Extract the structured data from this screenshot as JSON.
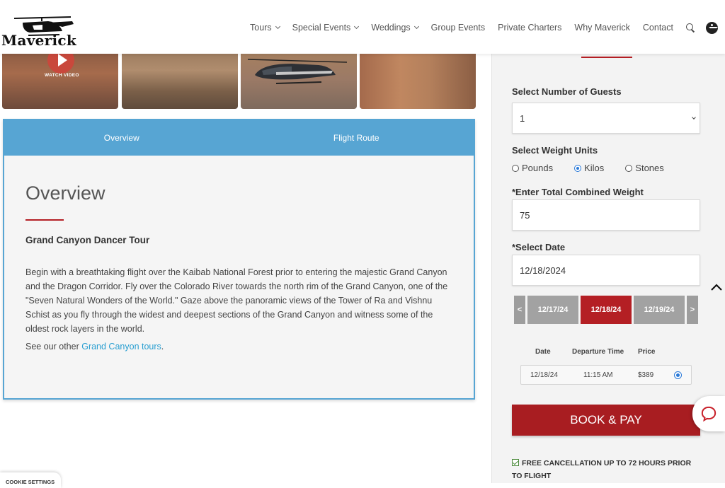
{
  "brand": {
    "name": "Maverick"
  },
  "nav": {
    "items": [
      {
        "label": "Tours",
        "dropdown": true
      },
      {
        "label": "Special Events",
        "dropdown": true
      },
      {
        "label": "Weddings",
        "dropdown": true
      },
      {
        "label": "Group Events",
        "dropdown": false
      },
      {
        "label": "Private Charters",
        "dropdown": false
      },
      {
        "label": "Why Maverick",
        "dropdown": false
      },
      {
        "label": "Contact",
        "dropdown": false
      }
    ],
    "icons": [
      "search-icon",
      "accessibility-icon"
    ]
  },
  "gallery": {
    "watch_label": "WATCH VIDEO"
  },
  "tabs": [
    {
      "label": "Overview"
    },
    {
      "label": "Flight Route"
    }
  ],
  "overview": {
    "title": "Overview",
    "tour_name": "Grand Canyon Dancer Tour",
    "description": "Begin with a breathtaking flight over the Kaibab National Forest prior to entering the majestic Grand Canyon and the Dragon Corridor. Fly over the Colorado River towards the north rim of the Grand Canyon, one of the \"Seven Natural Wonders of the World.\" Gaze above the panoramic views of the Tower of Ra and Vishnu Schist as you fly through the widest and deepest sections of the Grand Canyon and witness some of the oldest rock layers in the world.",
    "see_prefix": "See our other ",
    "see_link": "Grand Canyon tours",
    "see_suffix": "."
  },
  "booking": {
    "guests_label": "Select Number of Guests",
    "guests_value": "1",
    "weight_units_label": "Select Weight Units",
    "units": [
      {
        "label": "Pounds",
        "selected": false
      },
      {
        "label": "Kilos",
        "selected": true
      },
      {
        "label": "Stones",
        "selected": false
      }
    ],
    "weight_label": "*Enter Total Combined Weight",
    "weight_value": "75",
    "date_label": "*Select Date",
    "date_value": "12/18/2024",
    "prev_arrow": "<",
    "next_arrow": ">",
    "date_options": [
      "12/17/24",
      "12/18/24",
      "12/19/24"
    ],
    "selected_date_index": 1,
    "times_headers": {
      "date": "Date",
      "departure": "Departure Time",
      "price": "Price"
    },
    "times": [
      {
        "date": "12/18/24",
        "departure": "11:15 AM",
        "price": "$389",
        "selected": true
      }
    ],
    "book_label": "BOOK & PAY",
    "free_cancel": "FREE CANCELLATION UP TO 72 HOURS PRIOR TO FLIGHT"
  },
  "cookie": {
    "label": "COOKIE SETTINGS"
  },
  "colors": {
    "accent_red": "#b41f24",
    "tab_blue": "#57a5d3",
    "link_blue": "#2a9fd1",
    "selected_radio": "#2979d8"
  }
}
